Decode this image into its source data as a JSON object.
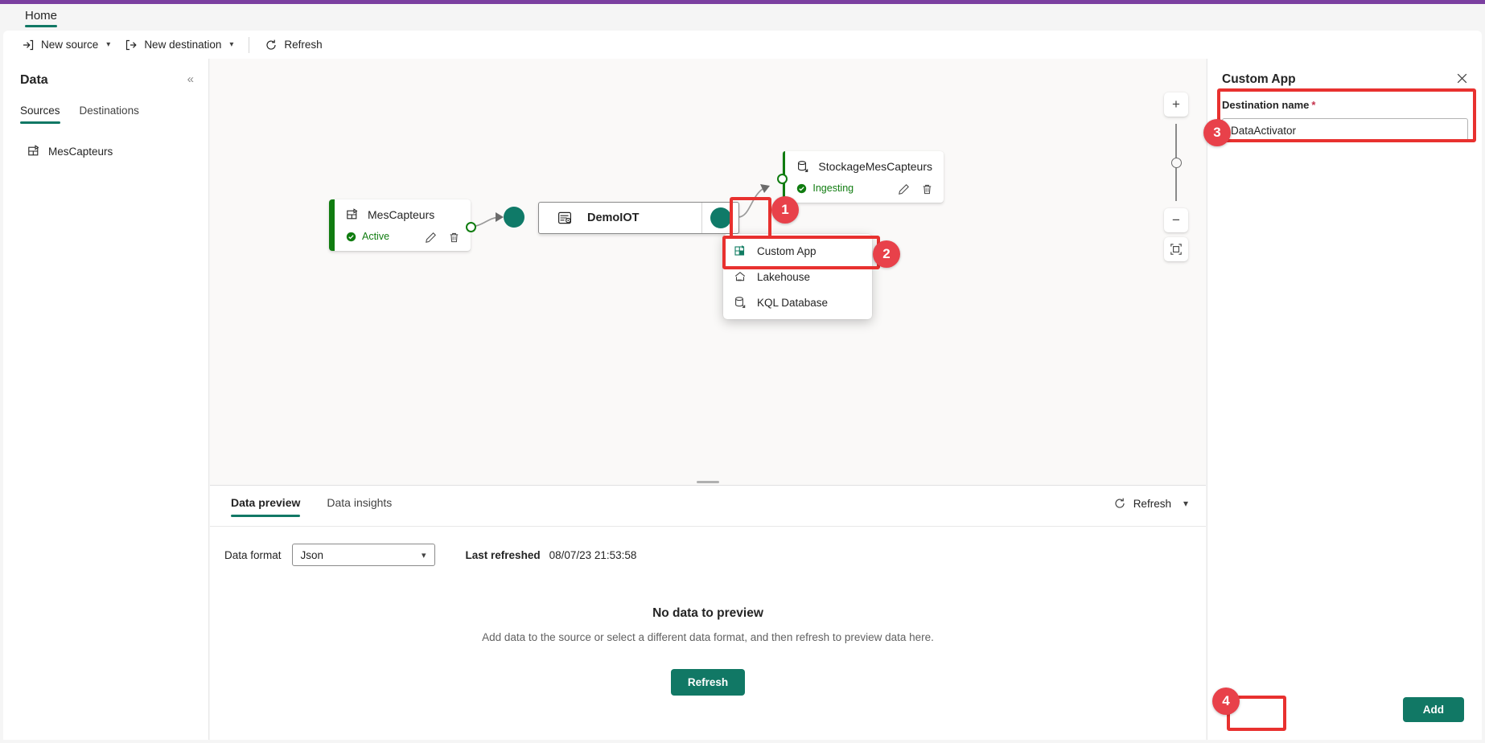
{
  "window": {
    "accent_purple": "#7b3fa0",
    "accent_teal": "#117865",
    "accent_green": "#107c10",
    "annotation_red": "#e8312f"
  },
  "ribbon": {
    "tab_home": "Home",
    "new_source": "New source",
    "new_destination": "New destination",
    "refresh": "Refresh"
  },
  "data_pane": {
    "title": "Data",
    "collapse_glyph": "«",
    "tabs": [
      {
        "label": "Sources",
        "active": true
      },
      {
        "label": "Destinations",
        "active": false
      }
    ],
    "items": [
      {
        "label": "MesCapteurs",
        "icon": "eventstream-icon"
      }
    ]
  },
  "canvas": {
    "source_node": {
      "title": "MesCapteurs",
      "status": "Active",
      "icon": "eventstream-icon",
      "edit_icon": "pencil-icon",
      "delete_icon": "trash-icon"
    },
    "stream_node": {
      "title": "DemoIOT",
      "icon": "eventstream-node-icon",
      "add_icon": "plus-icon"
    },
    "destination_node": {
      "title": "StockageMesCapteurs",
      "status": "Ingesting",
      "icon": "kql-database-icon",
      "edit_icon": "pencil-icon",
      "delete_icon": "trash-icon"
    },
    "context_menu": [
      {
        "label": "Custom App",
        "icon": "custom-app-icon",
        "highlighted": true
      },
      {
        "label": "Lakehouse",
        "icon": "lakehouse-icon",
        "highlighted": false
      },
      {
        "label": "KQL Database",
        "icon": "kql-database-icon",
        "highlighted": false
      }
    ],
    "zoom_controls": {
      "zoom_in": "+",
      "zoom_out": "−",
      "fit_to_screen": "fit-to-screen-icon"
    }
  },
  "preview": {
    "tabs": [
      {
        "label": "Data preview",
        "active": true
      },
      {
        "label": "Data insights",
        "active": false
      }
    ],
    "refresh_label": "Refresh",
    "data_format_label": "Data format",
    "data_format_value": "Json",
    "data_format_options": [
      "Json"
    ],
    "last_refreshed_label": "Last refreshed",
    "last_refreshed_value": "08/07/23 21:53:58",
    "empty_title": "No data to preview",
    "empty_subtitle": "Add data to the source or select a different data format, and then refresh to preview data here.",
    "empty_button": "Refresh"
  },
  "right_panel": {
    "title": "Custom App",
    "close_icon": "close-icon",
    "field_label": "Destination name",
    "required_marker": "*",
    "field_value": "DataActivator",
    "add_button": "Add"
  },
  "annotations": {
    "badges": [
      {
        "number": "1",
        "target": "stream-node-add-button"
      },
      {
        "number": "2",
        "target": "context-menu-custom-app"
      },
      {
        "number": "3",
        "target": "destination-name-field"
      },
      {
        "number": "4",
        "target": "add-button"
      }
    ]
  }
}
